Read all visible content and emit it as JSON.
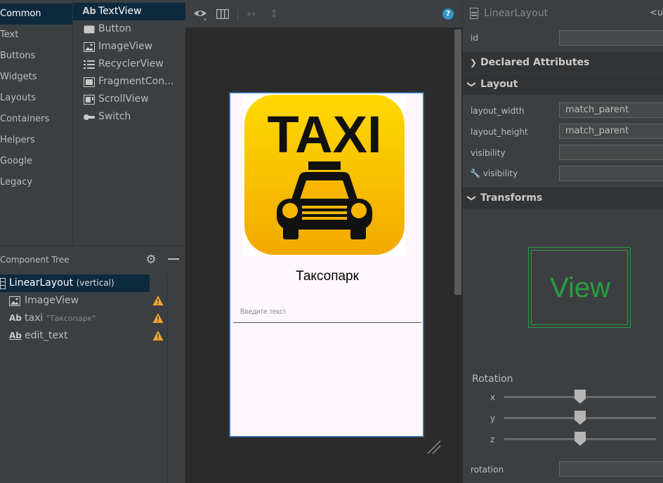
{
  "palette": {
    "categories": [
      "Common",
      "Text",
      "Buttons",
      "Widgets",
      "Layouts",
      "Containers",
      "Helpers",
      "Google",
      "Legacy"
    ],
    "items": [
      {
        "label": "TextView",
        "icon": "textview-icon",
        "glyph": "Ab"
      },
      {
        "label": "Button",
        "icon": "button-icon",
        "glyph": ""
      },
      {
        "label": "ImageView",
        "icon": "imageview-icon",
        "glyph": ""
      },
      {
        "label": "RecyclerView",
        "icon": "recyclerview-icon",
        "glyph": ""
      },
      {
        "label": "FragmentCon...",
        "icon": "fragmentcontainer-icon",
        "glyph": ""
      },
      {
        "label": "ScrollView",
        "icon": "scrollview-icon",
        "glyph": ""
      },
      {
        "label": "Switch",
        "icon": "switch-icon",
        "glyph": ""
      }
    ]
  },
  "tree": {
    "title": "Component Tree",
    "nodes": [
      {
        "label": "LinearLayout",
        "sub": "(vertical)",
        "icon": "linearlayout-icon"
      },
      {
        "label": "ImageView",
        "sub": "",
        "icon": "imageview-icon",
        "warning": true
      },
      {
        "label": "taxi",
        "sub": "\"Таксопарк\"",
        "icon": "textview-icon",
        "glyph": "Ab",
        "warning": true
      },
      {
        "label": "edit_text",
        "sub": "",
        "icon": "edittext-icon",
        "glyph": "Ab",
        "warning": true
      }
    ]
  },
  "preview": {
    "taxi_sign": "TAXI",
    "title": "Таксопарк",
    "edit_hint": "Введите текст"
  },
  "attributes": {
    "title": "LinearLayout",
    "tag": "<ur",
    "id_label": "id",
    "id_value": "",
    "sections": {
      "declared": "Declared Attributes",
      "layout": "Layout",
      "transforms": "Transforms"
    },
    "layout_rows": [
      {
        "label": "layout_width",
        "value": "match_parent"
      },
      {
        "label": "layout_height",
        "value": "match_parent"
      },
      {
        "label": "visibility",
        "value": ""
      },
      {
        "label": "visibility",
        "value": "",
        "tool": true
      }
    ],
    "view_preview_text": "View",
    "rotation": {
      "title": "Rotation",
      "axes": [
        "x",
        "y",
        "z"
      ],
      "field_label": "rotation",
      "field_value": ""
    }
  },
  "colors": {
    "accent": "#0d293e",
    "warning": "#f0a732",
    "transform_preview": "#2a9d3f",
    "taxi_yellow": "#f7b500"
  }
}
